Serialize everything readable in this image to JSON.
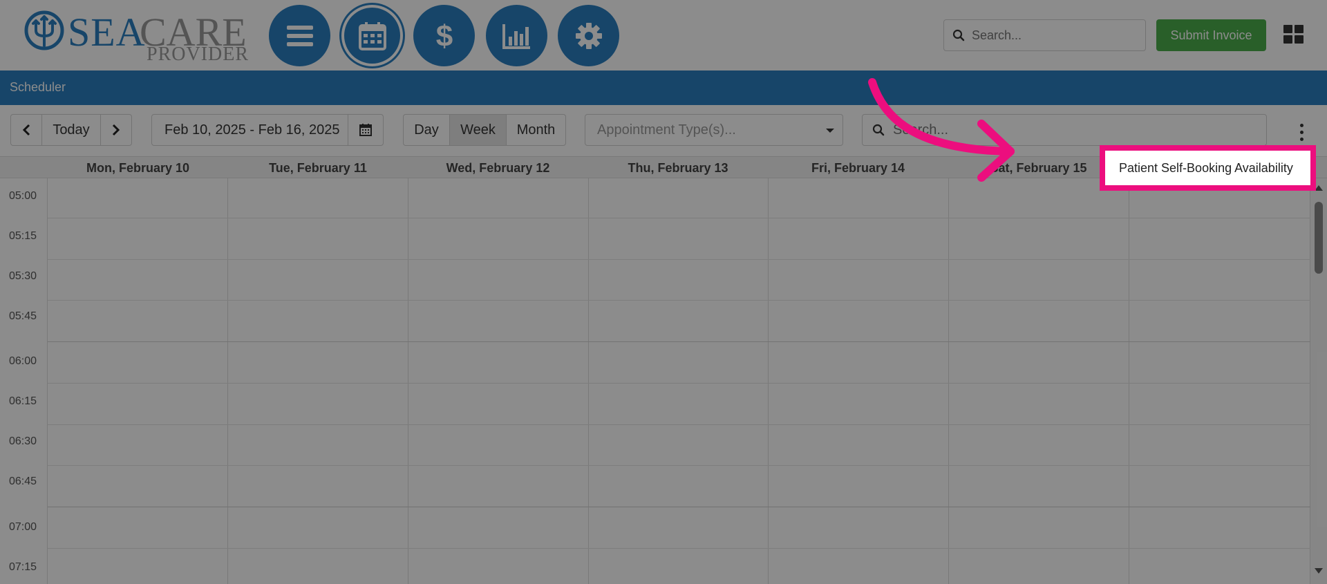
{
  "brand": {
    "sea": "SEA",
    "care": "CARE",
    "provider": "PROVIDER"
  },
  "nav": [
    {
      "icon": "menu-icon"
    },
    {
      "icon": "calendar-icon"
    },
    {
      "icon": "dollar-icon"
    },
    {
      "icon": "bar-chart-icon"
    },
    {
      "icon": "gear-icon"
    }
  ],
  "header": {
    "search_placeholder": "Search...",
    "submit_invoice": "Submit Invoice"
  },
  "section": {
    "title": "Scheduler"
  },
  "toolbar": {
    "prev": "‹",
    "today": "Today",
    "next": "›",
    "date_range": "Feb 10, 2025 - Feb 16, 2025",
    "views": [
      "Day",
      "Week",
      "Month"
    ],
    "active_view": "Week",
    "appointment_types_placeholder": "Appointment Type(s)...",
    "search_placeholder": "Search..."
  },
  "days": [
    "Mon, February 10",
    "Tue, February 11",
    "Wed, February 12",
    "Thu, February 13",
    "Fri, February 14",
    "Sat, February 15"
  ],
  "times": [
    "05:00",
    "05:15",
    "05:30",
    "05:45",
    "06:00",
    "06:15",
    "06:30",
    "06:45",
    "07:00",
    "07:15"
  ],
  "popup": {
    "item": "Patient Self-Booking Availability"
  },
  "colors": {
    "brand_blue": "#2a7fbf",
    "success_green": "#4cae4c",
    "highlight_pink": "#ec0e7e"
  }
}
